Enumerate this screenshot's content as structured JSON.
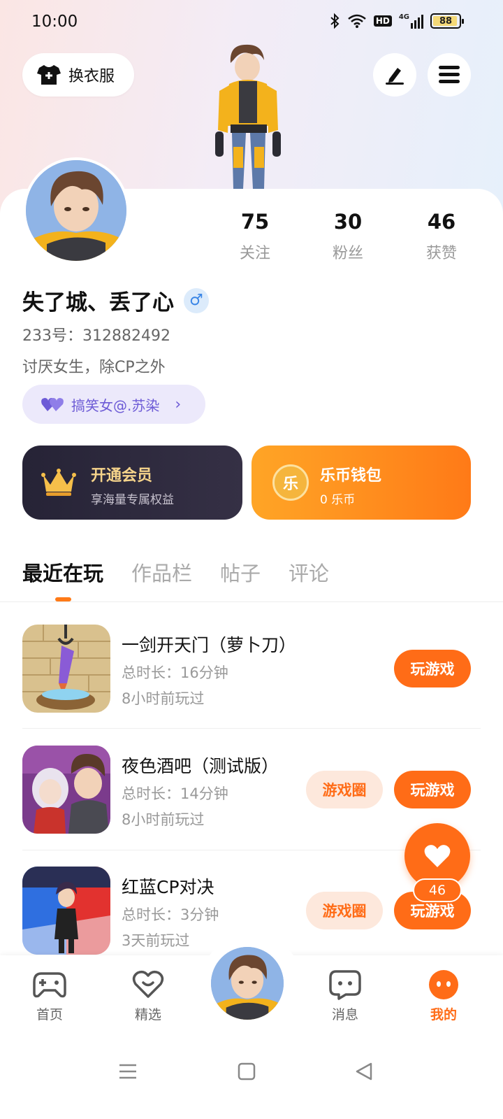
{
  "status_bar": {
    "time": "10:00",
    "hd": "HD",
    "network": "4G",
    "battery": "88"
  },
  "header": {
    "outfit_button": "换衣服",
    "edit_icon": "pen-icon",
    "menu_icon": "menu-icon"
  },
  "profile": {
    "stats": [
      {
        "value": "75",
        "label": "关注"
      },
      {
        "value": "30",
        "label": "粉丝"
      },
      {
        "value": "46",
        "label": "获赞"
      }
    ],
    "nickname": "失了城、丢了心",
    "gender": "♂",
    "uid": "233号：312882492",
    "bio": "讨厌女生，除CP之外",
    "cp_tag": "搞笑女@.苏染"
  },
  "cards": {
    "vip": {
      "title": "开通会员",
      "subtitle": "享海量专属权益"
    },
    "wallet": {
      "title": "乐币钱包",
      "subtitle": "0 乐币",
      "coin_glyph": "乐"
    }
  },
  "tabs": [
    "最近在玩",
    "作品栏",
    "帖子",
    "评论"
  ],
  "games": [
    {
      "title": "一剑开天门（萝卜刀）",
      "duration": "总时长：16分钟",
      "last_played": "8小时前玩过",
      "play": "玩游戏",
      "circle": ""
    },
    {
      "title": "夜色酒吧（测试版）",
      "duration": "总时长：14分钟",
      "last_played": "8小时前玩过",
      "play": "玩游戏",
      "circle": "游戏圈"
    },
    {
      "title": "红蓝CP对决",
      "duration": "总时长：3分钟",
      "last_played": "3天前玩过",
      "play": "玩游戏",
      "circle": "游戏圈"
    }
  ],
  "fab": {
    "count": "46"
  },
  "bottom_nav": [
    {
      "label": "首页",
      "icon": "gamepad-icon"
    },
    {
      "label": "精选",
      "icon": "heart-outline-icon"
    },
    {
      "label": "",
      "icon": "avatar"
    },
    {
      "label": "消息",
      "icon": "chat-icon"
    },
    {
      "label": "我的",
      "icon": "profile-icon"
    }
  ],
  "colors": {
    "accent": "#ff6c17",
    "vip_bg": "#262336",
    "cp_tag": "#6d5bd6"
  }
}
